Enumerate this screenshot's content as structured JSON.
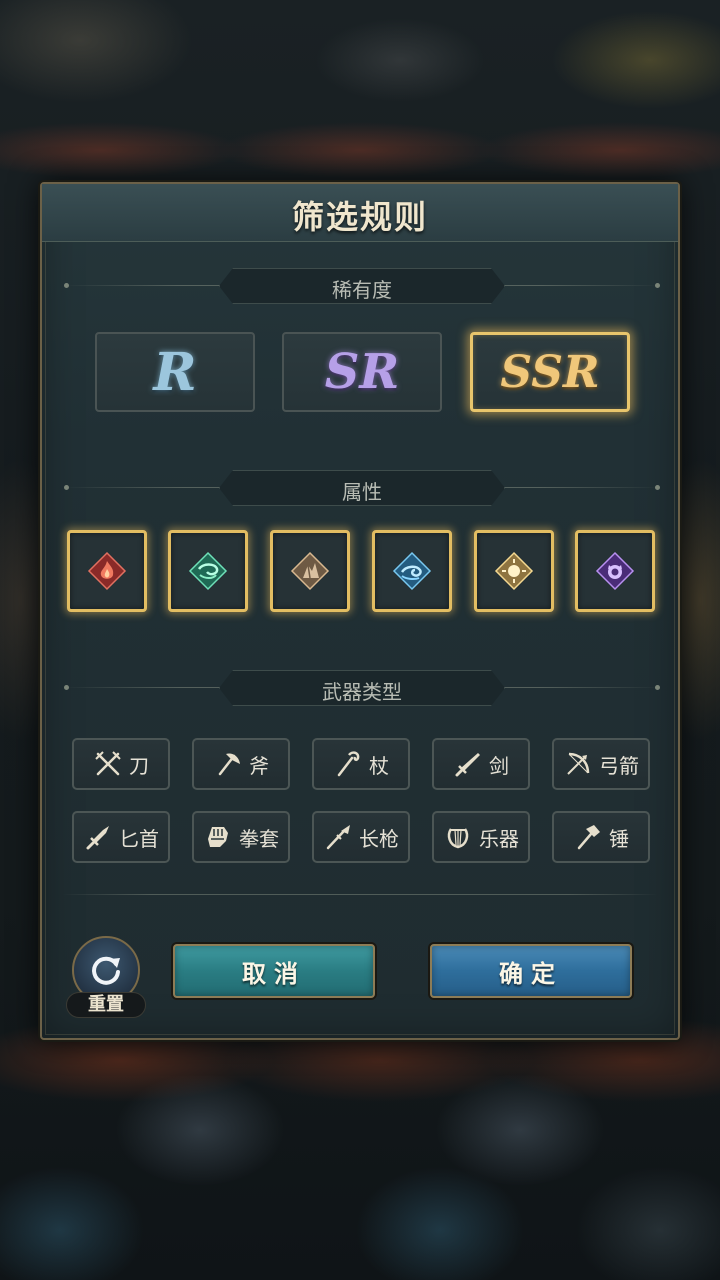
{
  "title": "筛选规则",
  "sections": {
    "rarity": "稀有度",
    "element": "属性",
    "weapon": "武器类型"
  },
  "rarity": [
    {
      "label": "R",
      "selected": false,
      "color": "#9cc6dd"
    },
    {
      "label": "SR",
      "selected": false,
      "color": "#b6a0e8"
    },
    {
      "label": "SSR",
      "selected": true,
      "color": "#f0c77a"
    }
  ],
  "elements": [
    {
      "icon": "fire-element-icon",
      "color": "#c8403c",
      "selected": true
    },
    {
      "icon": "wind-element-icon",
      "color": "#3cc8a0",
      "selected": true
    },
    {
      "icon": "earth-element-icon",
      "color": "#a88a6a",
      "selected": true
    },
    {
      "icon": "water-element-icon",
      "color": "#4aa6d8",
      "selected": true
    },
    {
      "icon": "light-element-icon",
      "color": "#e8c87a",
      "selected": true
    },
    {
      "icon": "dark-element-icon",
      "color": "#8a5ad0",
      "selected": true
    }
  ],
  "weapons": [
    {
      "label": "刀",
      "icon": "crossed-blades-icon"
    },
    {
      "label": "斧",
      "icon": "axe-icon"
    },
    {
      "label": "杖",
      "icon": "staff-icon"
    },
    {
      "label": "剑",
      "icon": "sword-icon"
    },
    {
      "label": "弓箭",
      "icon": "bow-icon"
    },
    {
      "label": "匕首",
      "icon": "dagger-icon"
    },
    {
      "label": "拳套",
      "icon": "gauntlet-icon"
    },
    {
      "label": "长枪",
      "icon": "spear-icon"
    },
    {
      "label": "乐器",
      "icon": "lyre-icon"
    },
    {
      "label": "锤",
      "icon": "hammer-icon"
    }
  ],
  "buttons": {
    "reset": "重置",
    "cancel": "取消",
    "confirm": "确定"
  }
}
